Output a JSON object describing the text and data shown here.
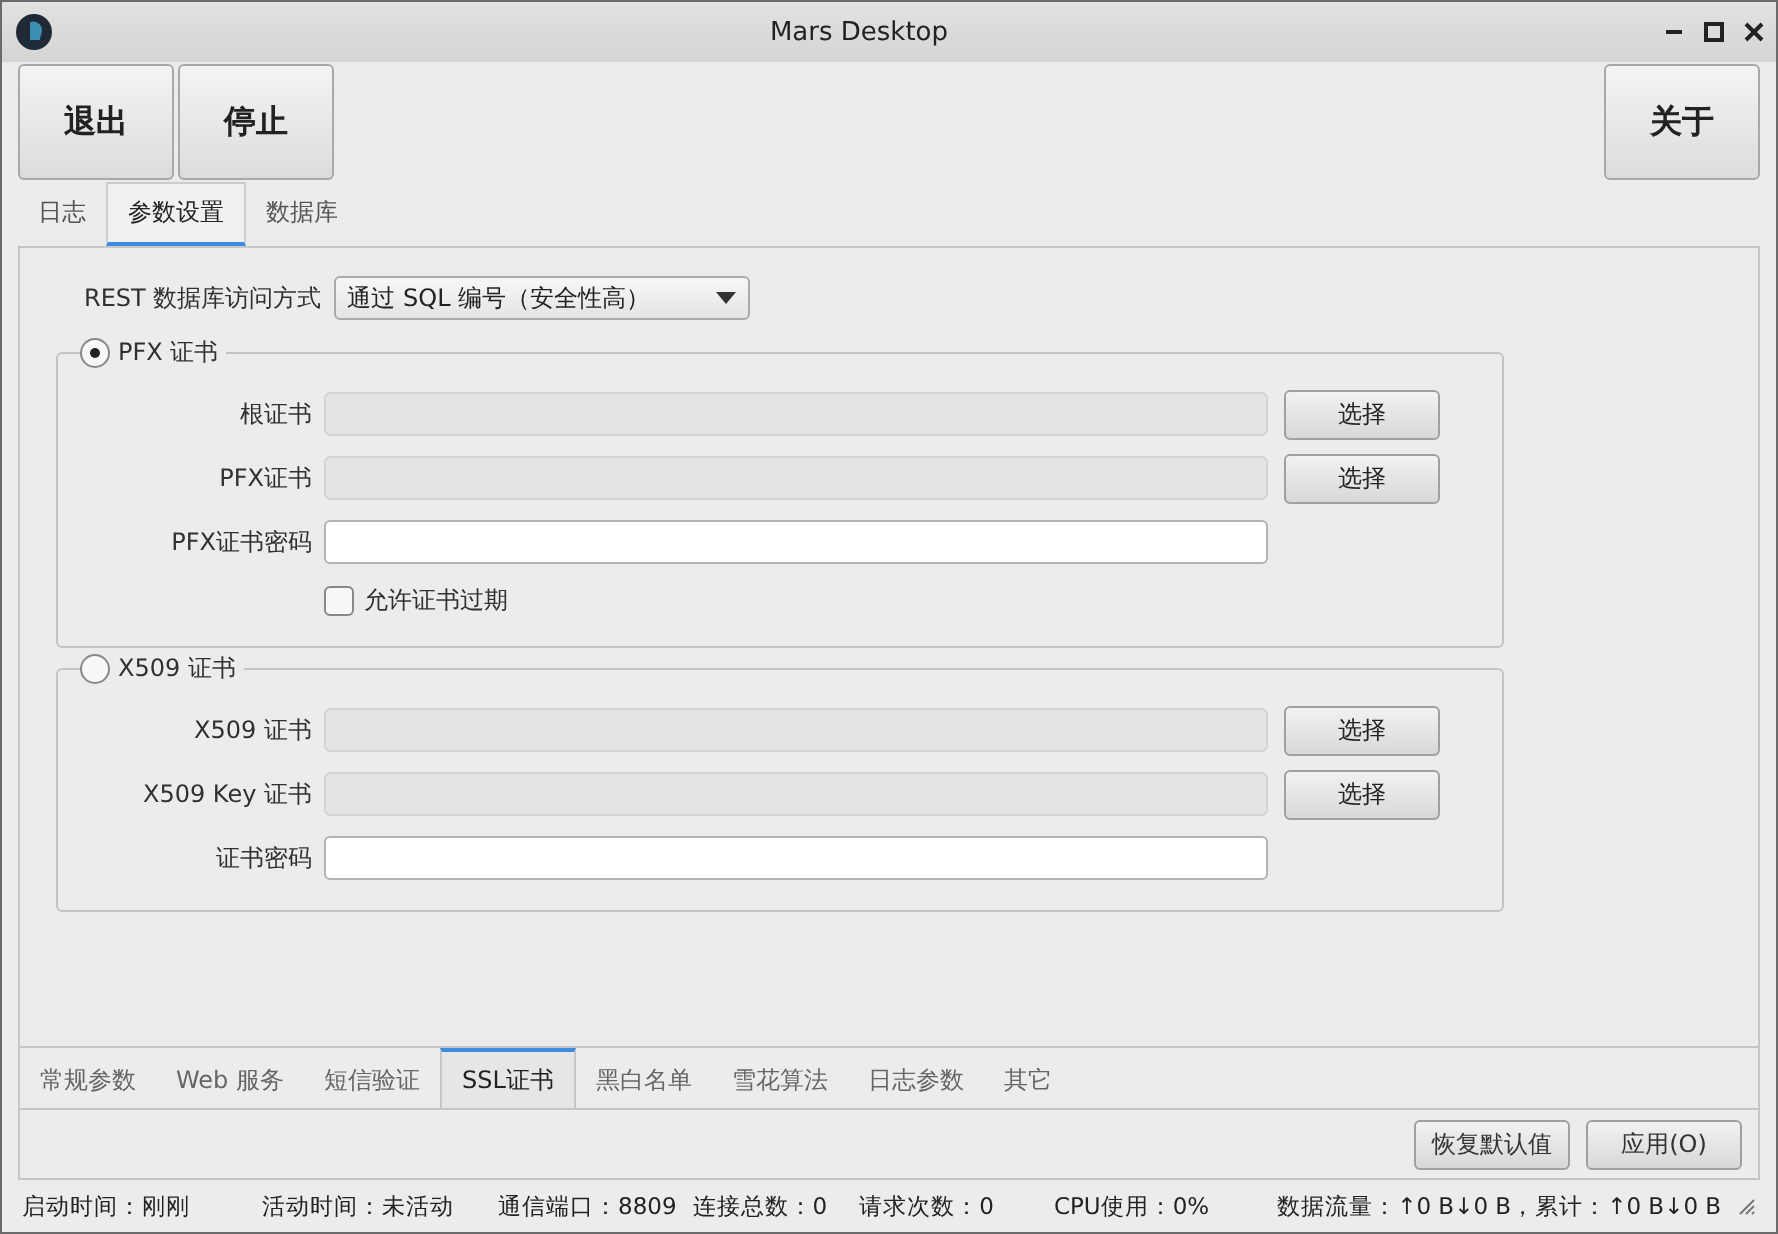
{
  "window": {
    "title": "Mars Desktop"
  },
  "toolbar": {
    "left": [
      "退出",
      "停止"
    ],
    "right": [
      "关于"
    ]
  },
  "tabs": [
    {
      "label": "日志",
      "selected": false
    },
    {
      "label": "参数设置",
      "selected": true
    },
    {
      "label": "数据库",
      "selected": false
    }
  ],
  "access": {
    "label": "REST 数据库访问方式",
    "value": "通过 SQL 编号（安全性高）"
  },
  "groups": [
    {
      "title": "PFX 证书",
      "selected": true,
      "rows": [
        {
          "label": "根证书",
          "readonly": true,
          "button": "选择"
        },
        {
          "label": "PFX证书",
          "readonly": true,
          "button": "选择"
        },
        {
          "label": "PFX证书密码",
          "readonly": false
        }
      ],
      "checkbox": {
        "label": "允许证书过期",
        "checked": false
      }
    },
    {
      "title": "X509 证书",
      "selected": false,
      "rows": [
        {
          "label": "X509 证书",
          "readonly": true,
          "button": "选择"
        },
        {
          "label": "X509 Key 证书",
          "readonly": true,
          "button": "选择"
        },
        {
          "label": "证书密码",
          "readonly": false
        }
      ]
    }
  ],
  "bottom_tabs": [
    {
      "label": "常规参数",
      "selected": false
    },
    {
      "label": "Web 服务",
      "selected": false
    },
    {
      "label": "短信验证",
      "selected": false
    },
    {
      "label": "SSL证书",
      "selected": true
    },
    {
      "label": "黑白名单",
      "selected": false
    },
    {
      "label": "雪花算法",
      "selected": false
    },
    {
      "label": "日志参数",
      "selected": false
    },
    {
      "label": "其它",
      "selected": false
    }
  ],
  "actions": [
    "恢复默认值",
    "应用(O)"
  ],
  "status_bar": [
    "启动时间：刚刚",
    "活动时间：未活动",
    "通信端口：8809",
    "连接总数：0",
    "请求次数：0",
    "CPU使用：0%",
    "数据流量：↑0 B↓0 B，累计：↑0 B↓0 B"
  ]
}
